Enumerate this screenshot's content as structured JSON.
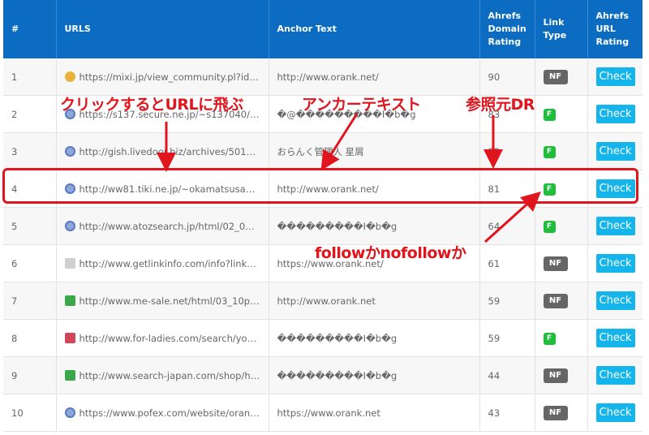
{
  "table": {
    "headers": [
      "#",
      "URLS",
      "Anchor Text",
      "Ahrefs Domain Rating",
      "Link Type",
      "Ahrefs URL Rating"
    ],
    "rows": [
      {
        "num": "1",
        "url": "https://mixi.jp/view_community.pl?id=4...",
        "anchor": "http://www.orank.net/",
        "dr": "90",
        "type": "NF",
        "action": "Check",
        "icon": "mixi-icon"
      },
      {
        "num": "2",
        "url": "https://s137.secure.ne.jp/~s137040/ne...",
        "anchor": "�@���������I�b�g",
        "dr": "83",
        "type": "F",
        "action": "Check",
        "icon": "globe-icon"
      },
      {
        "num": "3",
        "url": "http://gish.livedoor.biz/archives/50124...",
        "anchor": "おらんく管理人 星屑",
        "dr": "82",
        "type": "F",
        "action": "Check",
        "icon": "globe-icon"
      },
      {
        "num": "4",
        "url": "http://ww81.tiki.ne.jp/~okamatsusan/k...",
        "anchor": "http://www.orank.net/",
        "dr": "81",
        "type": "F",
        "action": "Check",
        "icon": "globe-icon"
      },
      {
        "num": "5",
        "url": "http://www.atozsearch.jp/html/02_08p...",
        "anchor": "���������I�b�g",
        "dr": "64",
        "type": "F",
        "action": "Check",
        "icon": "globe-icon"
      },
      {
        "num": "6",
        "url": "http://www.getlinkinfo.com/info?link=h...",
        "anchor": "https://www.orank.net/",
        "dr": "61",
        "type": "NF",
        "action": "Check",
        "icon": "link-icon"
      },
      {
        "num": "7",
        "url": "http://www.me-sale.net/html/03_10p1...",
        "anchor": "http://www.orank.net",
        "dr": "59",
        "type": "NF",
        "action": "Check",
        "icon": "green-icon"
      },
      {
        "num": "8",
        "url": "http://www.for-ladies.com/search/yomi...",
        "anchor": "���������I�b�g",
        "dr": "59",
        "type": "F",
        "action": "Check",
        "icon": "pink-icon"
      },
      {
        "num": "9",
        "url": "http://www.search-japan.com/shop/ht...",
        "anchor": "���������I�b�g",
        "dr": "44",
        "type": "NF",
        "action": "Check",
        "icon": "leaf-icon"
      },
      {
        "num": "10",
        "url": "https://www.pofex.com/website/orank....",
        "anchor": "https://www.orank.net",
        "dr": "43",
        "type": "NF",
        "action": "Check",
        "icon": "globe-icon"
      }
    ]
  },
  "annotations": {
    "url_note": "クリックするとURLに飛ぶ",
    "anchor_note": "アンカーテキスト",
    "dr_note": "参照元DR",
    "follow_note": "followかnofollowか"
  },
  "colors": {
    "header_bg": "#0b6cc2",
    "annotation_red": "#e0151d",
    "check_button": "#14b5ea",
    "follow_badge": "#1ebd3a",
    "nofollow_badge": "#666666"
  }
}
